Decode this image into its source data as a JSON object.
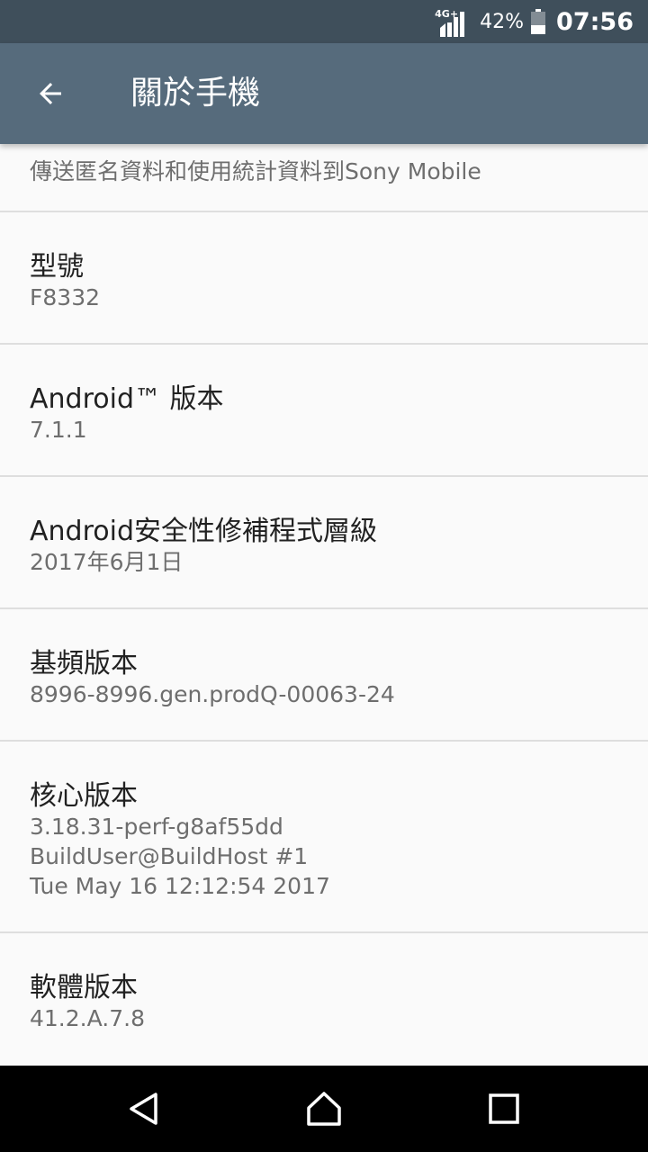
{
  "status_bar": {
    "network_label": "4G+",
    "battery_percent": "42%",
    "battery_level": 0.42,
    "time": "07:56",
    "icons": [
      "signal-icon",
      "battery-icon"
    ]
  },
  "app_bar": {
    "title": "關於手機",
    "back_icon": "arrow-left-icon"
  },
  "items": [
    {
      "title": "",
      "lines": [
        "傳送匿名資料和使用統計資料到Sony Mobile"
      ]
    },
    {
      "title": "型號",
      "lines": [
        "F8332"
      ]
    },
    {
      "title": "Android™ 版本",
      "lines": [
        "7.1.1"
      ]
    },
    {
      "title": "Android安全性修補程式層級",
      "lines": [
        "2017年6月1日"
      ]
    },
    {
      "title": "基頻版本",
      "lines": [
        "8996-8996.gen.prodQ-00063-24"
      ]
    },
    {
      "title": "核心版本",
      "lines": [
        "3.18.31-perf-g8af55dd",
        "BuildUser@BuildHost #1",
        "Tue May 16 12:12:54 2017"
      ]
    },
    {
      "title": "軟體版本",
      "lines": [
        "41.2.A.7.8"
      ]
    }
  ],
  "nav_bar": {
    "icons": [
      "back-triangle-icon",
      "home-icon",
      "recents-icon"
    ]
  },
  "colors": {
    "status_bar": "#3f4f5b",
    "app_bar": "#566b7c",
    "background": "#fafafa"
  }
}
